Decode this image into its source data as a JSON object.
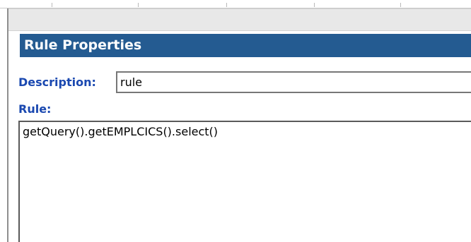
{
  "panel": {
    "title": "Rule Properties"
  },
  "description": {
    "label": "Description:",
    "value": "rule"
  },
  "rule": {
    "label": "Rule:",
    "value": "getQuery().getEMPLCICS().select()"
  },
  "colors": {
    "header_background": "#245b91",
    "header_text": "#ffffff",
    "label_text": "#1a48b0"
  }
}
